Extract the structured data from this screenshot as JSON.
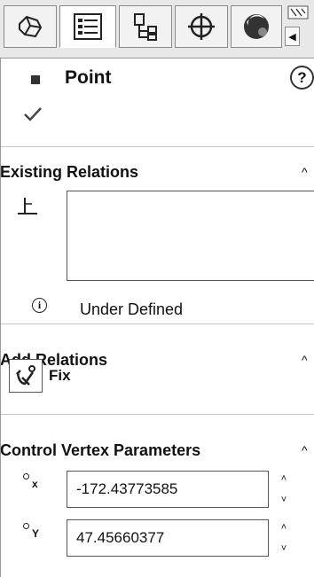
{
  "tabs": [
    {
      "icon": "part-features-icon"
    },
    {
      "icon": "property-manager-icon",
      "active": true
    },
    {
      "icon": "configuration-manager-icon"
    },
    {
      "icon": "dimxpert-icon"
    },
    {
      "icon": "display-manager-icon"
    }
  ],
  "header": {
    "title": "Point",
    "help_label": "?",
    "ok_label": "✓"
  },
  "existing_relations": {
    "title": "Existing Relations",
    "collapse": "^",
    "status_icon": "i",
    "status": "Under Defined"
  },
  "add_relations": {
    "title": "Add Relations",
    "collapse": "^",
    "fix_label": "Fix"
  },
  "control_vertex": {
    "title": "Control Vertex Parameters",
    "collapse": "^",
    "x_label": "x",
    "y_label": "Y",
    "x_value": "-172.43773585",
    "y_value": "47.45660377",
    "spin_up": "˄",
    "spin_down": "˅"
  },
  "colors": {
    "toolbar_bg": "#e8e8e8",
    "panel_bg": "#ffffff",
    "divider": "#c8c8c8",
    "border": "#555555"
  }
}
